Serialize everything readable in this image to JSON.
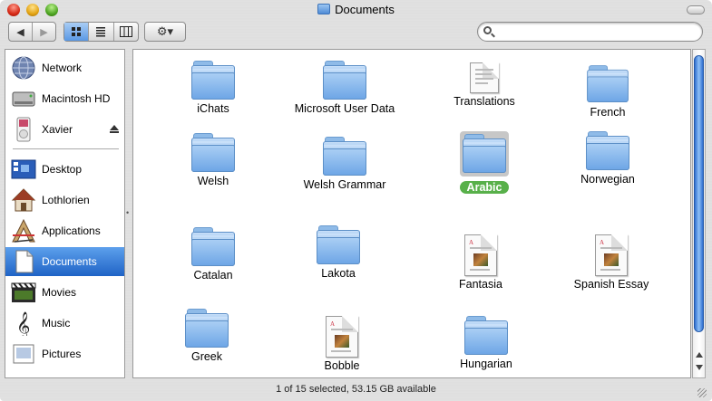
{
  "window": {
    "title": "Documents"
  },
  "toolbar": {
    "nav": [
      "◀",
      "▶"
    ],
    "views": [
      "icon-view",
      "list-view",
      "column-view"
    ],
    "action_label": "⚙▾",
    "search": {
      "value": "",
      "placeholder": ""
    }
  },
  "sidebar": {
    "devices": [
      {
        "label": "Network",
        "icon": "network-globe-icon"
      },
      {
        "label": "Macintosh HD",
        "icon": "hard-disk-icon"
      },
      {
        "label": "Xavier",
        "icon": "ipod-icon",
        "ejectable": true
      }
    ],
    "places": [
      {
        "label": "Desktop",
        "icon": "desktop-icon"
      },
      {
        "label": "Lothlorien",
        "icon": "home-icon"
      },
      {
        "label": "Applications",
        "icon": "applications-icon"
      },
      {
        "label": "Documents",
        "icon": "documents-icon",
        "selected": true
      },
      {
        "label": "Movies",
        "icon": "movies-icon"
      },
      {
        "label": "Music",
        "icon": "music-icon"
      },
      {
        "label": "Pictures",
        "icon": "pictures-icon"
      }
    ]
  },
  "files": [
    {
      "name": "iChats",
      "kind": "folder"
    },
    {
      "name": "Microsoft User Data",
      "kind": "folder"
    },
    {
      "name": "Translations",
      "kind": "document-text"
    },
    {
      "name": "French",
      "kind": "folder"
    },
    {
      "name": "Welsh",
      "kind": "folder"
    },
    {
      "name": "Welsh Grammar",
      "kind": "folder"
    },
    {
      "name": "Arabic",
      "kind": "folder",
      "selected": true
    },
    {
      "name": "Norwegian",
      "kind": "folder"
    },
    {
      "name": "Catalan",
      "kind": "folder"
    },
    {
      "name": "Lakota",
      "kind": "folder"
    },
    {
      "name": "Fantasia",
      "kind": "document-picture"
    },
    {
      "name": "Spanish Essay",
      "kind": "document-picture"
    },
    {
      "name": "Greek",
      "kind": "folder"
    },
    {
      "name": "Bobble",
      "kind": "document-picture"
    },
    {
      "name": "Hungarian",
      "kind": "folder"
    }
  ],
  "status": {
    "text": "1 of 15 selected, 53.15 GB available"
  },
  "colors": {
    "selection": "#1f63c6",
    "selected_label": "#58b04a",
    "folder": "#6ea6e6"
  }
}
